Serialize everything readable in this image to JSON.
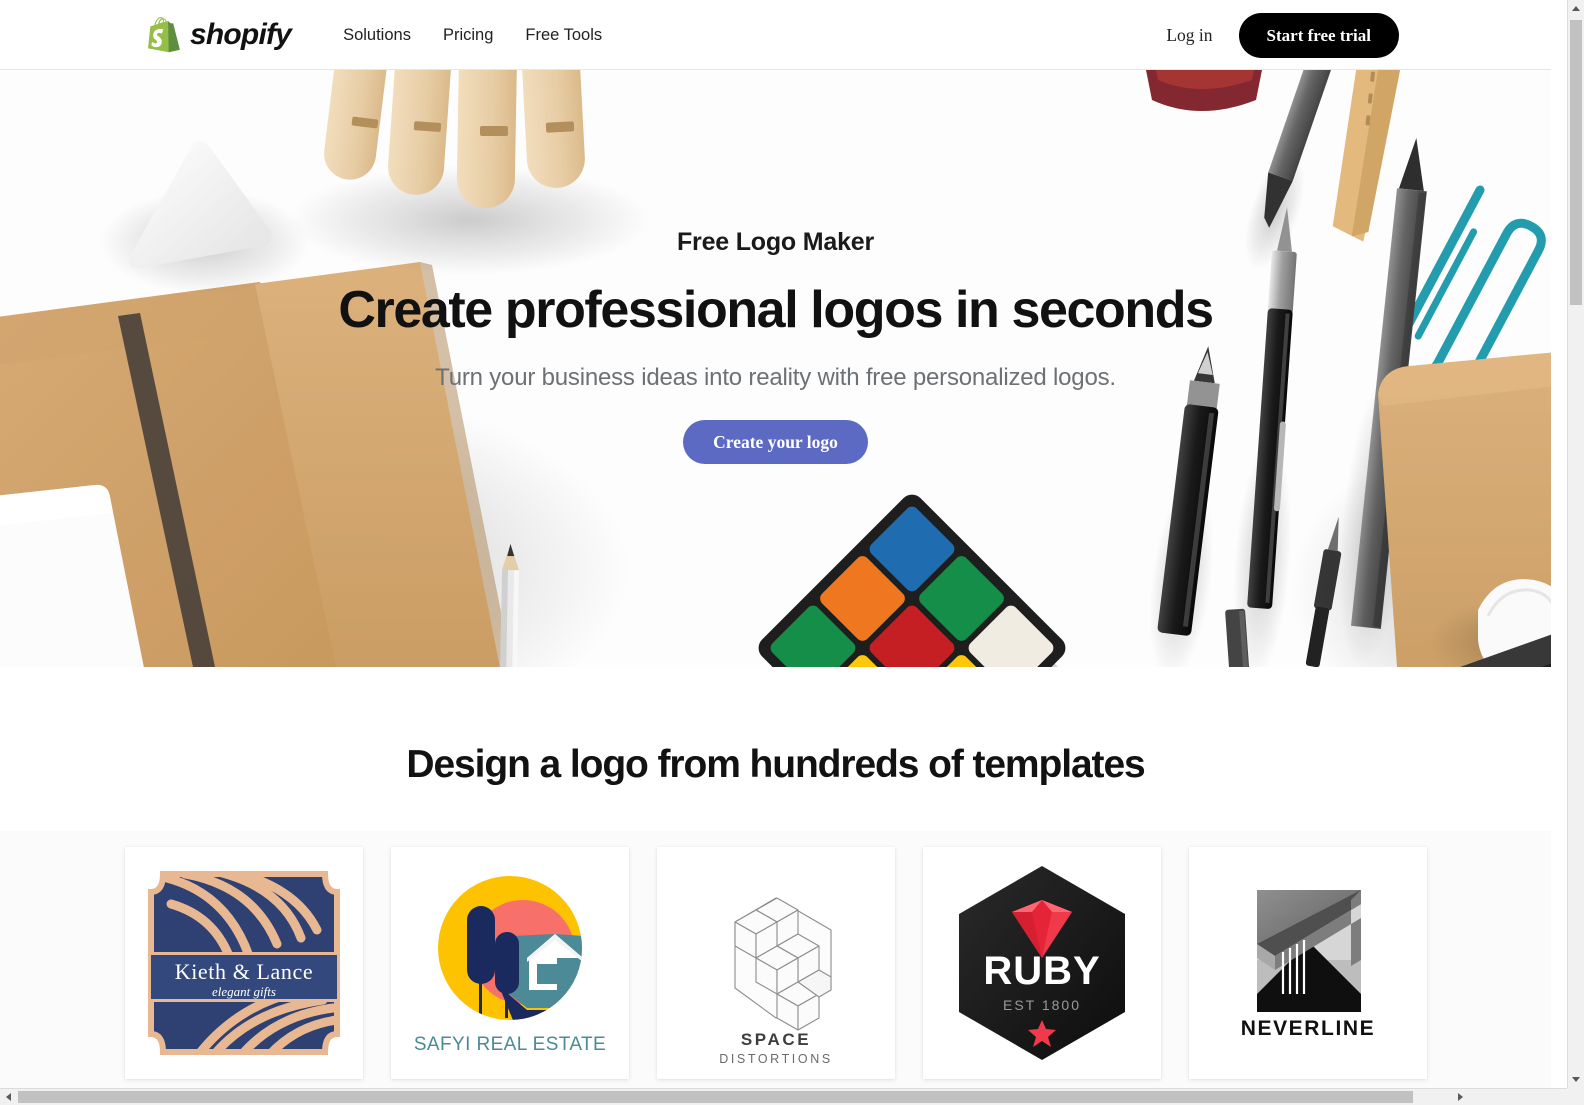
{
  "header": {
    "brand": "shopify",
    "brand_icon": "shopify-bag-icon",
    "nav": [
      {
        "label": "Solutions"
      },
      {
        "label": "Pricing"
      },
      {
        "label": "Free Tools"
      }
    ],
    "login_label": "Log in",
    "trial_label": "Start free trial"
  },
  "hero": {
    "eyebrow": "Free Logo Maker",
    "heading": "Create professional logos in seconds",
    "subheading": "Turn your business ideas into reality with free personalized logos.",
    "cta_label": "Create your logo",
    "cta_color": "#5c6ac4",
    "background_description": "Flat-lay desk photo: wooden mannequin hand, kraft notebooks, spiral notepad, white triangular eraser, black pens, graphite pencils, teal paperclip, Rubik's cube"
  },
  "templates": {
    "heading": "Design a logo from hundreds of templates",
    "cards": [
      {
        "name": "kieth-and-lance",
        "title": "Kieth & Lance",
        "tagline": "elegant gifts",
        "colors": {
          "primary": "#2e4172",
          "accent": "#e8b893"
        }
      },
      {
        "name": "safyi-real-estate",
        "title": "SAFYI REAL ESTATE",
        "tagline": "",
        "colors": {
          "primary": "#fdc300",
          "accent": "#f8706a",
          "secondary": "#4b8a96",
          "dark": "#1b2a5e"
        }
      },
      {
        "name": "space-distortions",
        "title": "SPACE",
        "tagline": "DISTORTIONS",
        "colors": {
          "primary": "#3d3d3d",
          "accent": "#b9b9b9"
        }
      },
      {
        "name": "ruby",
        "title": "RUBY",
        "tagline": "EST 1800",
        "colors": {
          "primary": "#1b1b1b",
          "accent": "#f03a4b"
        }
      },
      {
        "name": "neverline",
        "title": "NEVERLINE",
        "tagline": "",
        "colors": {
          "primary": "#111111",
          "accent": "#8c8c8c"
        }
      }
    ]
  },
  "scrollbars": {
    "vertical_icon_up": "scroll-up-arrow-icon",
    "vertical_icon_down": "scroll-down-arrow-icon",
    "horizontal_icon_left": "scroll-left-arrow-icon",
    "horizontal_icon_right": "scroll-right-arrow-icon"
  }
}
